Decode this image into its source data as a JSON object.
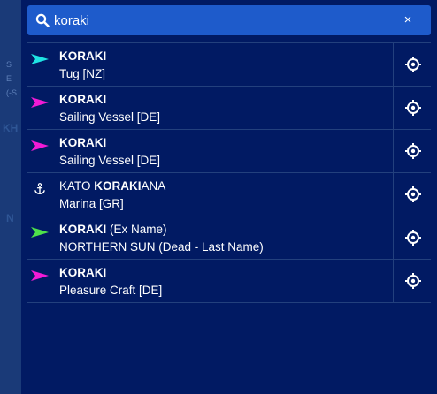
{
  "search": {
    "value": "koraki",
    "clear_label": "×"
  },
  "colors": {
    "tug": "#1fe3e3",
    "sailing": "#f21bd6",
    "pleasure": "#f21bd6",
    "unknown_dead": "#4ee24a",
    "panel": "#011a63",
    "search_bar": "#1e5bcb"
  },
  "backdrop": {
    "t1": "S",
    "t2": "E",
    "t3": "(-S",
    "t4": "KH",
    "t5": "N"
  },
  "results": [
    {
      "icon": "tug-vessel-icon",
      "pre": "",
      "match": "KORAKI",
      "post": "",
      "subtitle": "Tug [NZ]"
    },
    {
      "icon": "sailing-vessel-icon",
      "pre": "",
      "match": "KORAKI",
      "post": "",
      "subtitle": "Sailing Vessel [DE]"
    },
    {
      "icon": "sailing-vessel-icon",
      "pre": "",
      "match": "KORAKI",
      "post": "",
      "subtitle": "Sailing Vessel [DE]"
    },
    {
      "icon": "anchor-icon",
      "pre": "KATO ",
      "match": "KORAKI",
      "post": "ANA",
      "subtitle": "Marina [GR]"
    },
    {
      "icon": "vessel-icon",
      "pre": "",
      "match": "KORAKI",
      "post": " (Ex Name)",
      "subtitle": "NORTHERN SUN (Dead - Last Name)"
    },
    {
      "icon": "pleasure-craft-icon",
      "pre": "",
      "match": "KORAKI",
      "post": "",
      "subtitle": "Pleasure Craft [DE]"
    }
  ]
}
